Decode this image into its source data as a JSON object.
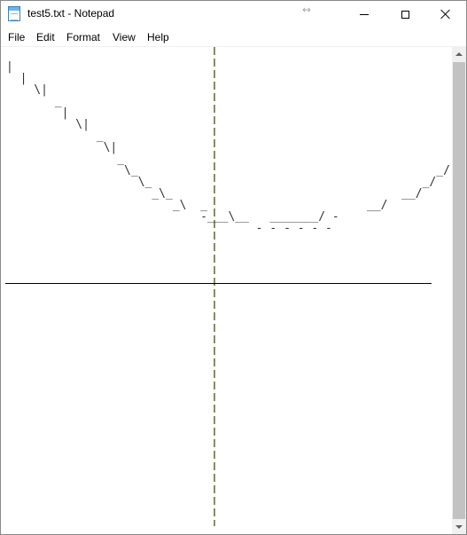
{
  "window": {
    "title": "test5.txt - Notepad",
    "resize_hint": "↔"
  },
  "menu": {
    "file": "File",
    "edit": "Edit",
    "format": "Format",
    "view": "View",
    "help": "Help"
  },
  "document": {
    "text": "|                                                                           |\n  |                                                                       |\n    \\|                                                                   _|\n       _                                                                |\n        |                                                             /\n          \\|                                                        _|\n             _                                                     |\n              \\|                                                 _/\n                _                                               |\n                 \\_                                           _/\n                   \\_                                       _/\n                     _\\_                                 __/\n                        _\\  _                       __/\n                            -___\\__   _______/ -\n                                    - - - - - -"
  },
  "colors": {
    "axis": "#8a8a6a",
    "scroll_thumb": "#c2c2c2"
  }
}
